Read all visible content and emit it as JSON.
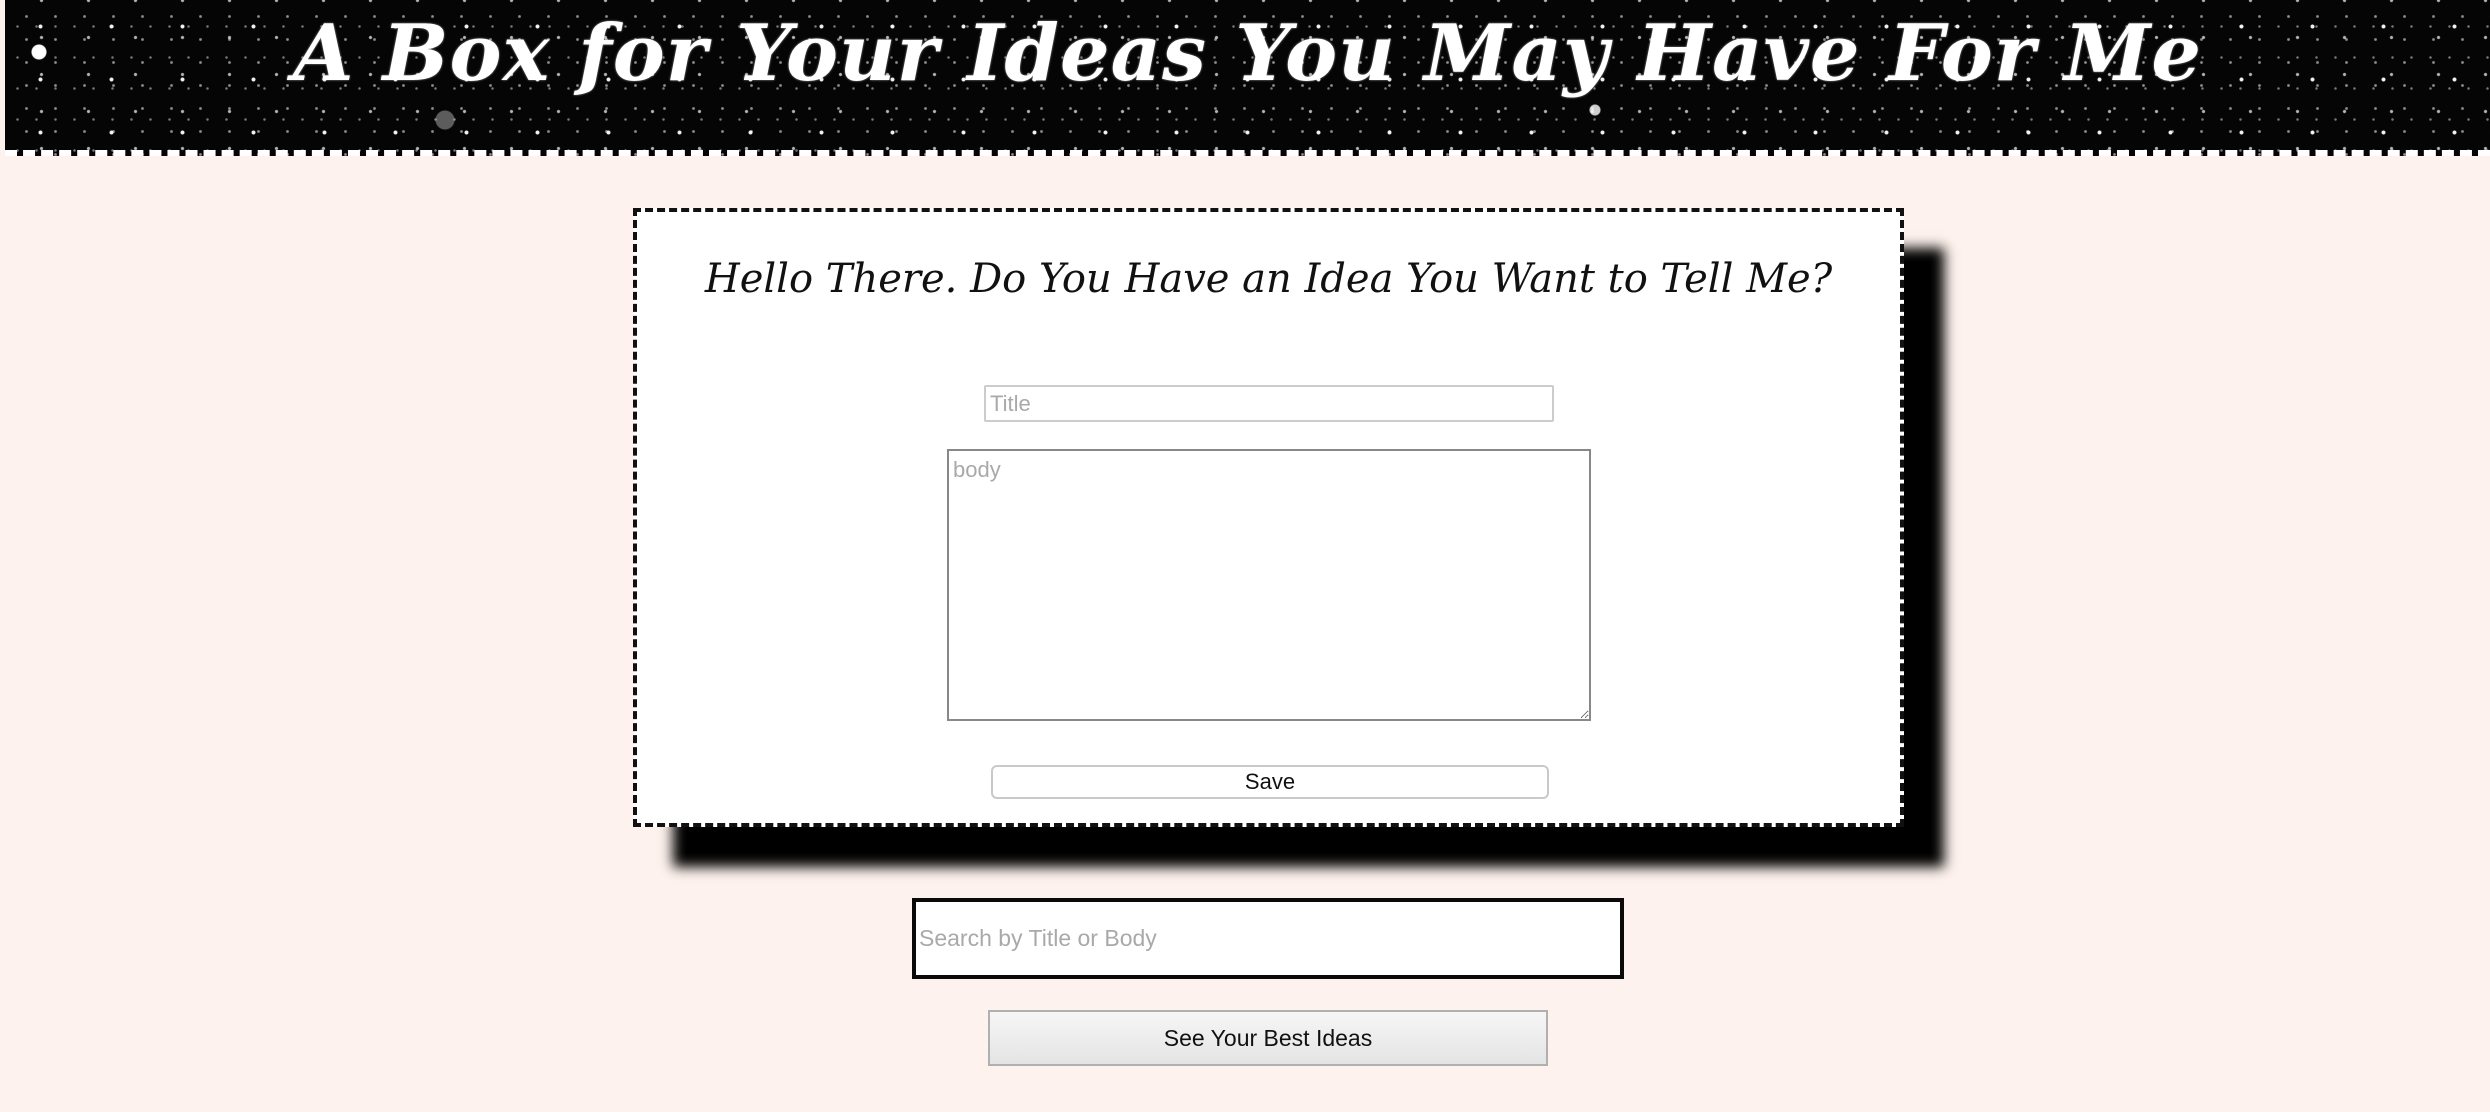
{
  "header": {
    "title": "A Box for Your Ideas You May Have For Me"
  },
  "form": {
    "heading": "Hello There. Do You Have an Idea You Want to Tell Me?",
    "title_placeholder": "Title",
    "title_value": "",
    "body_placeholder": "body",
    "body_value": "",
    "save_label": "Save"
  },
  "search": {
    "placeholder": "Search by Title or Body",
    "value": ""
  },
  "best_ideas_button": {
    "label": "See Your Best Ideas"
  },
  "colors": {
    "page_background": "#fdf2ed",
    "header_background": "#050505",
    "header_text": "#ffffff",
    "card_background": "#ffffff",
    "card_border": "#111111",
    "card_shadow": "#000000"
  },
  "icons": {
    "header_background": "starfield-background"
  }
}
